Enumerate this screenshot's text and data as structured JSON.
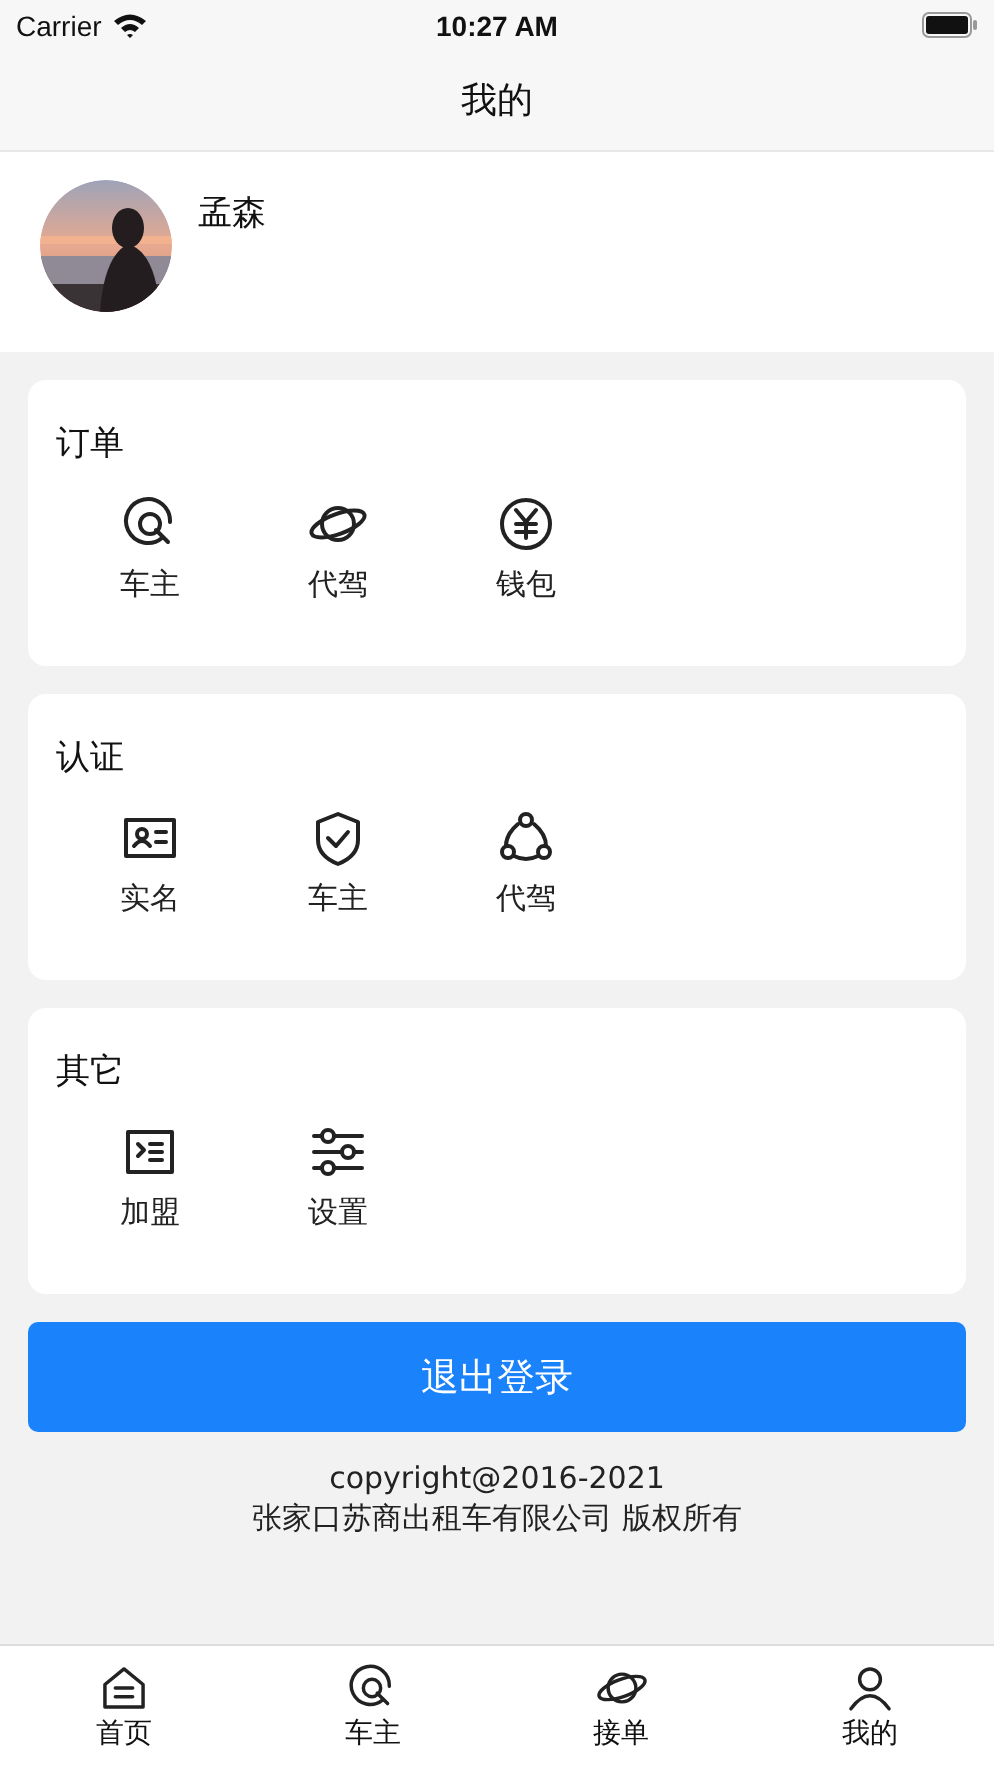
{
  "status_bar": {
    "carrier": "Carrier",
    "time": "10:27 AM"
  },
  "nav": {
    "title": "我的"
  },
  "profile": {
    "name": "孟森"
  },
  "sections": [
    {
      "title": "订单",
      "items": [
        {
          "label": "车主",
          "kind": "steering"
        },
        {
          "label": "代驾",
          "kind": "planet"
        },
        {
          "label": "钱包",
          "kind": "yen"
        }
      ]
    },
    {
      "title": "认证",
      "items": [
        {
          "label": "实名",
          "kind": "idcard"
        },
        {
          "label": "车主",
          "kind": "shield"
        },
        {
          "label": "代驾",
          "kind": "nodes"
        }
      ]
    },
    {
      "title": "其它",
      "items": [
        {
          "label": "加盟",
          "kind": "console"
        },
        {
          "label": "设置",
          "kind": "sliders"
        }
      ]
    }
  ],
  "logout_button": "退出登录",
  "footer": [
    "copyright@2016-2021",
    "张家口苏商出租车有限公司 版权所有"
  ],
  "tab_bar": [
    {
      "label": "首页",
      "kind": "home"
    },
    {
      "label": "车主",
      "kind": "steering"
    },
    {
      "label": "接单",
      "kind": "planet"
    },
    {
      "label": "我的",
      "kind": "person"
    }
  ]
}
